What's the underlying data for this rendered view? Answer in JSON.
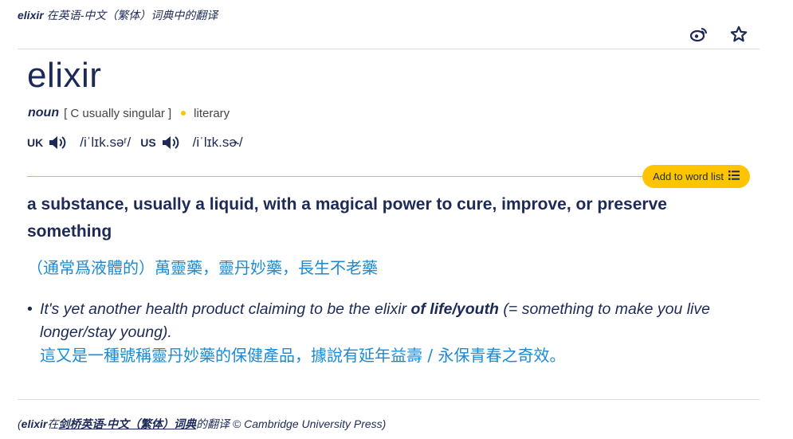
{
  "header": {
    "word": "elixir",
    "title_suffix": " 在英语-中文（繁体）词典中的翻译"
  },
  "entry": {
    "headword": "elixir",
    "pos": "noun",
    "grammar": "[ C usually singular ]",
    "usage": "literary",
    "uk_label": "UK",
    "uk_ipa": "/iˈlɪk.səʳ/",
    "us_label": "US",
    "us_ipa": "/iˈlɪk.sɚ/",
    "add_to_list": "Add to word list",
    "definition": "a substance, usually a liquid, with a magical power to cure, improve, or preserve something",
    "translation": "（通常爲液體的）萬靈藥，靈丹妙藥，長生不老藥",
    "example": {
      "bullet": "•",
      "pre": "It's yet another health product claiming to be the elixir ",
      "bold": "of life/youth",
      "post": " (= something to make you live longer/stay young).",
      "translation": "這又是一種號稱靈丹妙藥的保健產品，據說有延年益壽 / 永保青春之奇效。"
    }
  },
  "footer": {
    "open": "(",
    "word": "elixir",
    "in": "在",
    "dict": "剑桥英语-中文（繁体）词典",
    "suffix": "的翻译 © Cambridge University Press)"
  },
  "icons": {
    "share": "weibo-icon",
    "favorite": "star-icon",
    "speaker": "speaker-icon",
    "list": "list-icon"
  },
  "colors": {
    "navy": "#1d2a57",
    "yellow": "#fec400",
    "blue": "#1a8ad4"
  }
}
